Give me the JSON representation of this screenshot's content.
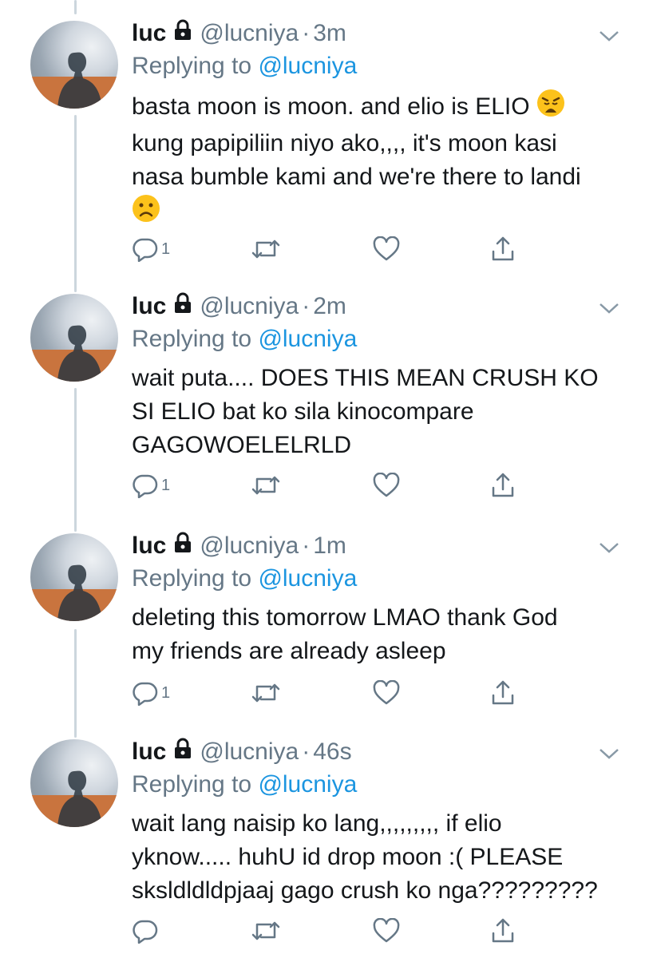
{
  "tweets": [
    {
      "name": "luc",
      "handle": "@lucniya",
      "time": "3m",
      "replying_prefix": "Replying to ",
      "replying_handle": "@lucniya",
      "lines": [
        "basta moon is moon. and elio is ELIO",
        "kung papipiliin niyo ako,,,, it's moon kasi",
        "nasa bumble kami and we're there to landi"
      ],
      "emoji_after_line1": "weary-face-emoji",
      "emoji_line4": "slightly-frowning-face-emoji",
      "reply_count": "1"
    },
    {
      "name": "luc",
      "handle": "@lucniya",
      "time": "2m",
      "replying_prefix": "Replying to ",
      "replying_handle": "@lucniya",
      "lines": [
        "wait puta.... DOES THIS MEAN CRUSH KO",
        "SI ELIO bat ko sila kinocompare",
        "GAGOWOELELRLD"
      ],
      "reply_count": "1"
    },
    {
      "name": "luc",
      "handle": "@lucniya",
      "time": "1m",
      "replying_prefix": "Replying to ",
      "replying_handle": "@lucniya",
      "lines": [
        "deleting this tomorrow LMAO thank God",
        "my friends are already asleep"
      ],
      "reply_count": "1"
    },
    {
      "name": "luc",
      "handle": "@lucniya",
      "time": "46s",
      "replying_prefix": "Replying to ",
      "replying_handle": "@lucniya",
      "lines": [
        "wait lang naisip ko lang,,,,,,,,, if elio",
        "yknow..... huhU id drop moon :( PLEASE",
        "sksldldldpjaaj gago crush ko nga?????????"
      ],
      "reply_count": ""
    }
  ],
  "colors": {
    "text": "#14171a",
    "secondary": "#657786",
    "link": "#1b95e0",
    "thread_line": "#ccd6dd"
  },
  "icons": [
    "lock-icon",
    "chevron-down-icon",
    "reply-icon",
    "retweet-icon",
    "like-icon",
    "share-icon"
  ]
}
